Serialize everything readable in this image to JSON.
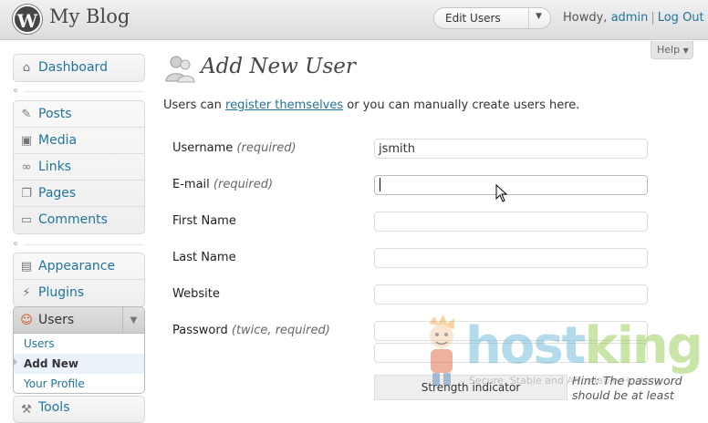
{
  "header": {
    "blog_name": "My Blog",
    "logo_letter": "W",
    "favorite_actions": "Edit Users",
    "howdy_prefix": "Howdy,",
    "username": "admin",
    "logout": "Log Out"
  },
  "help_tab": "Help",
  "sidebar": {
    "group1": [
      {
        "label": "Dashboard",
        "icon": "dashboard-icon"
      }
    ],
    "group2": [
      {
        "label": "Posts",
        "icon": "pin-icon"
      },
      {
        "label": "Media",
        "icon": "media-icon"
      },
      {
        "label": "Links",
        "icon": "link-icon"
      },
      {
        "label": "Pages",
        "icon": "pages-icon"
      },
      {
        "label": "Comments",
        "icon": "comment-icon"
      }
    ],
    "group3": [
      {
        "label": "Appearance",
        "icon": "appearance-icon"
      },
      {
        "label": "Plugins",
        "icon": "plug-icon"
      }
    ],
    "users": {
      "label": "Users",
      "submenu": [
        "Users",
        "Add New",
        "Your Profile"
      ]
    },
    "tools": "Tools"
  },
  "main": {
    "title": "Add New User",
    "intro_prefix": "Users can",
    "intro_link": "register themselves",
    "intro_suffix": "or you can manually create users here.",
    "fields": [
      {
        "label": "Username",
        "note": "(required)",
        "value": ""
      },
      {
        "label": "E-mail",
        "note": "(required)",
        "value": ""
      },
      {
        "label": "First Name",
        "note": "",
        "value": ""
      },
      {
        "label": "Last Name",
        "note": "",
        "value": ""
      },
      {
        "label": "Website",
        "note": "",
        "value": ""
      },
      {
        "label": "Password",
        "note": "(twice, required)",
        "value": ""
      }
    ],
    "username_value": "jsmith",
    "strength_indicator": "Strength indicator",
    "hint": "Hint: The password should be at least"
  },
  "watermark": {
    "host": "host",
    "king": "king",
    "tagline": "Secure, Stable and Affordable Hosting"
  }
}
